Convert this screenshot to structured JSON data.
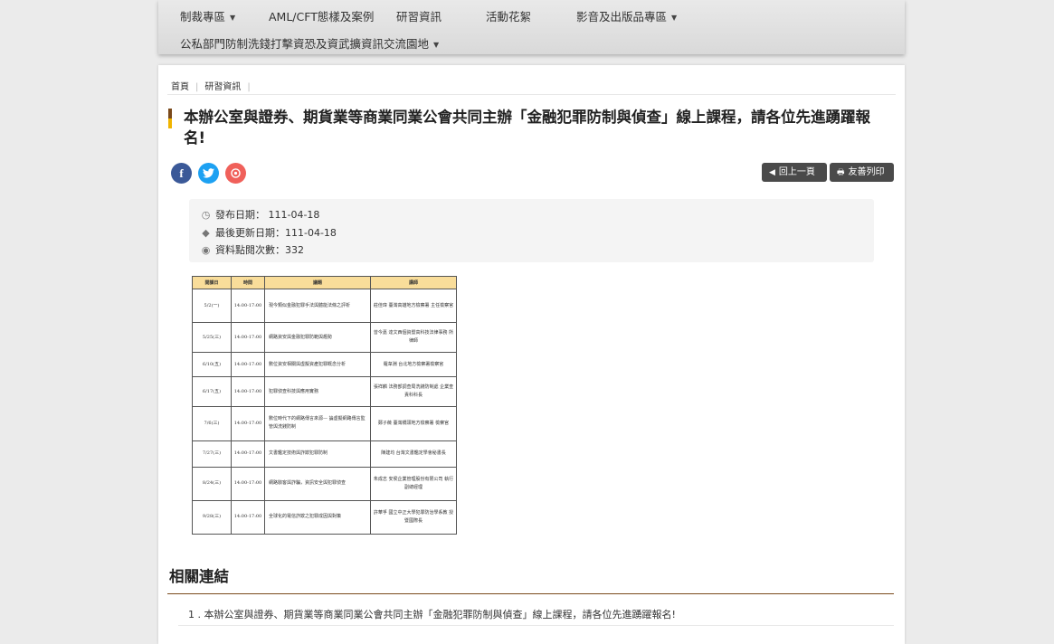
{
  "nav": {
    "items": [
      {
        "label": "制裁專區",
        "caret": "▼"
      },
      {
        "label": "AML/CFT態樣及案例",
        "caret": ""
      },
      {
        "label": "研習資訊",
        "caret": ""
      },
      {
        "label": "活動花絮",
        "caret": ""
      },
      {
        "label": "影音及出版品專區",
        "caret": "▼"
      },
      {
        "label": "公私部門防制洗錢打擊資恐及資武擴資訊交流園地",
        "caret": "▼"
      }
    ]
  },
  "breadcrumb": {
    "home": "首頁",
    "current": "研習資訊",
    "sep": "|"
  },
  "article": {
    "title": "本辦公室與證券、期貨業等商業同業公會共同主辦「金融犯罪防制與偵查」線上課程，請各位先進踴躍報名!",
    "social": {
      "facebook": "f"
    },
    "buttons": {
      "prev": "回上一頁",
      "print": "友善列印"
    },
    "meta": {
      "published_label": "發布日期：",
      "published": "111-04-18",
      "updated_label": "最後更新日期：",
      "updated": "111-04-18",
      "views_label": "資料點閱次數：",
      "views": "332"
    }
  },
  "schedule": {
    "headers": [
      "開課日",
      "時間",
      "議題",
      "講師"
    ],
    "rows": [
      {
        "date": "5/2(一)",
        "time": "14:00-17:00",
        "topic": "現今類似金融犯罪手法與體能法條之評析",
        "lecturer": "莊佳瑋 臺灣高雄地方檢察署 主任檢察官"
      },
      {
        "date": "5/25(三)",
        "time": "14:00-17:00",
        "topic": "網路資安與金融犯罪防範與趨勢",
        "lecturer": "曾今嘉 達文西個資暨高科技法律事務 所律師"
      },
      {
        "date": "6/10(五)",
        "time": "14:00-17:00",
        "topic": "數位資安相關與虛擬資產犯罪概念分析",
        "lecturer": "羅韋淵 台北地方檢察署檢察官"
      },
      {
        "date": "6/17(五)",
        "time": "14:00-17:00",
        "topic": "犯罪偵查科技與應用實務",
        "lecturer": "張祥麟 法務部調查局洗錢防制處 企業查責科科長"
      },
      {
        "date": "7/6(三)",
        "time": "14:00-17:00",
        "topic": "數位時代下的網路傳言來源— 論虛擬網路傳言監管與洗錢防制",
        "lecturer": "鄭子薇 臺灣橋頭地方檢察署 檢察官"
      },
      {
        "date": "7/27(三)",
        "time": "14:00-17:00",
        "topic": "文書鑑定技術與詐欺犯罪防制",
        "lecturer": "陳建均 台灣文書鑑定學會秘書長"
      },
      {
        "date": "8/24(三)",
        "time": "14:00-17:00",
        "topic": "網路駭客與詐騙，資訊安全與犯罪偵查",
        "lecturer": "朱成志 安侯企業管理股份有限公司 執行副總經理"
      },
      {
        "date": "9/28(三)",
        "time": "14:00-17:00",
        "topic": "全球化的電信詐欺之犯罪成因與對策",
        "lecturer": "許華孚 國立中正大學犯罪防治學系教 授暨國際長"
      }
    ]
  },
  "related": {
    "heading": "相關連結",
    "items": [
      {
        "num": "1 .",
        "label": "本辦公室與證券、期貨業等商業同業公會共同主辦「金融犯罪防制與偵查」線上課程，請各位先進踴躍報名!"
      }
    ]
  },
  "colors": {
    "accent_dark": "#7a4a1c",
    "accent_gold": "#f0b400",
    "table_header": "#f9dd9a",
    "button_bg": "#4a4a4a"
  }
}
